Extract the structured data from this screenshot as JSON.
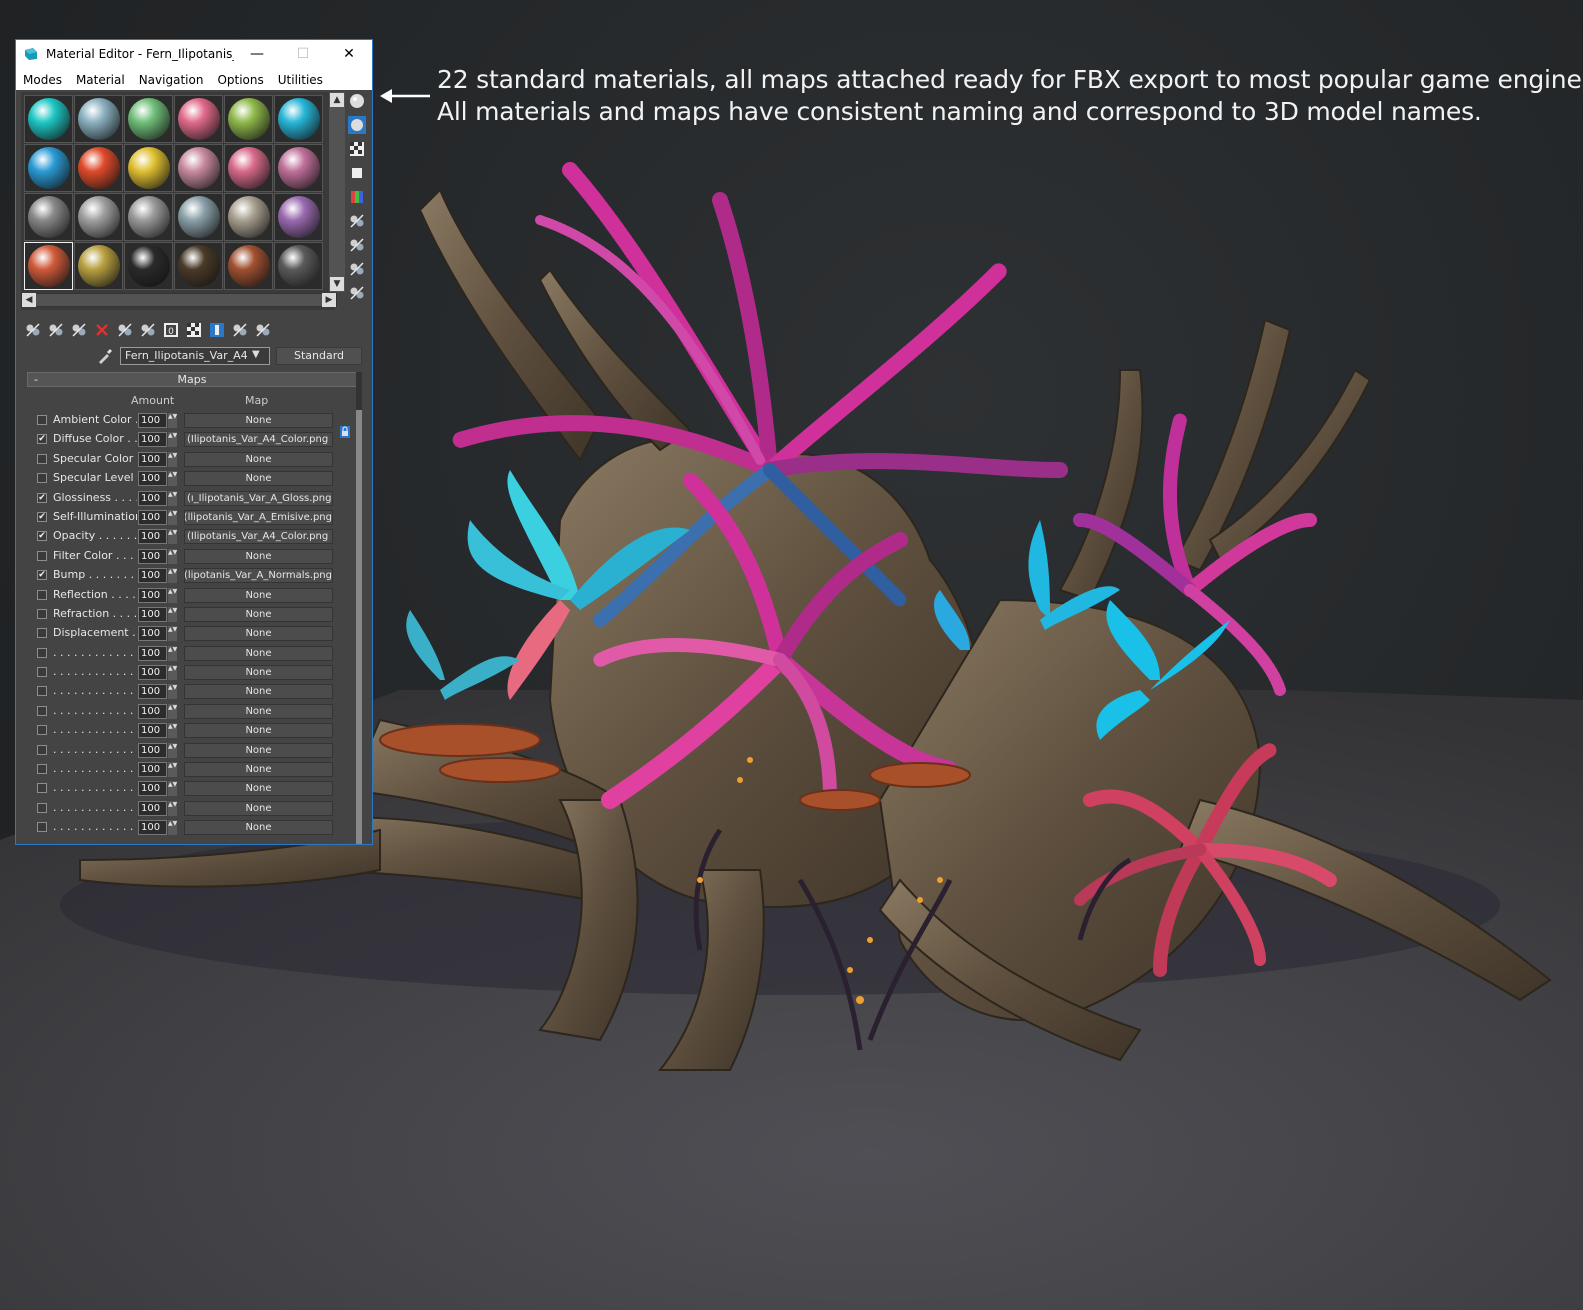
{
  "caption": {
    "line1": "22 standard materials, all maps attached ready for FBX export to most popular game engines.",
    "line2": "All materials and maps have consistent naming and correspond to 3D model names."
  },
  "window": {
    "title": "Material Editor - Fern_Ilipotanis_Va...",
    "app_icon": "3ds-max-icon",
    "minimize": "—",
    "maximize": "☐",
    "close": "✕"
  },
  "menu": [
    "Modes",
    "Material",
    "Navigation",
    "Options",
    "Utilities"
  ],
  "slots": [
    [
      "#1ec8c4",
      "#8ab0c0",
      "#6fbf7a",
      "#e06a8a",
      "#8fb84a",
      "#27b6d8"
    ],
    [
      "#2a9bd6",
      "#e04a2a",
      "#e0c030",
      "#c88aa0",
      "#d86a8a",
      "#c0709a"
    ],
    [
      "#888888",
      "#a0a0a0",
      "#9a9a9a",
      "#8aa0a8",
      "#a8a090",
      "#9a6ab0"
    ],
    [
      "#d05a3a",
      "#b8a040",
      "#2a2a2a",
      "#4a3a28",
      "#a05030",
      "#5a5a5a"
    ]
  ],
  "active_slot": 18,
  "side_tools": [
    "sample-type-icon",
    "backlight-icon",
    "background-icon",
    "sample-uv-tiling-icon",
    "video-color-check-icon",
    "make-preview-icon",
    "options-icon",
    "select-by-material-icon",
    "material-map-navigator-icon"
  ],
  "bottom_tools": [
    "get-material-icon",
    "put-to-scene-icon",
    "assign-to-selection-icon",
    "reset-map-icon",
    "make-unique-icon",
    "put-to-library-icon",
    "material-id-channel-icon",
    "show-shaded-in-viewport-icon",
    "show-end-result-icon",
    "go-to-parent-icon",
    "go-forward-to-sibling-icon"
  ],
  "material_name": "Fern_Ilipotanis_Var_A4",
  "material_type": "Standard",
  "maps_rollout": {
    "title": "Maps",
    "toggle": "-",
    "col_amount": "Amount",
    "col_map": "Map"
  },
  "maps": [
    {
      "label": "Ambient Color . .",
      "checked": false,
      "amount": "100",
      "map": "None",
      "assigned": false
    },
    {
      "label": "Diffuse Color . . .",
      "checked": true,
      "amount": "100",
      "map": "Ilipotanis_Var_A4_Color.png)",
      "assigned": true
    },
    {
      "label": "Specular Color",
      "checked": false,
      "amount": "100",
      "map": "None",
      "assigned": false
    },
    {
      "label": "Specular Level .",
      "checked": false,
      "amount": "100",
      "map": "None",
      "assigned": false
    },
    {
      "label": "Glossiness . . . .",
      "checked": true,
      "amount": "100",
      "map": "ı_Ilipotanis_Var_A_Gloss.png)",
      "assigned": true
    },
    {
      "label": "Self-Illumination .",
      "checked": true,
      "amount": "100",
      "map": "llipotanis_Var_A_Emisive.png)",
      "assigned": true
    },
    {
      "label": "Opacity . . . . . .",
      "checked": true,
      "amount": "100",
      "map": "Ilipotanis_Var_A4_Color.png)",
      "assigned": true
    },
    {
      "label": "Filter Color . . . .",
      "checked": false,
      "amount": "100",
      "map": "None",
      "assigned": false
    },
    {
      "label": "Bump . . . . . . .",
      "checked": true,
      "amount": "100",
      "map": "lipotanis_Var_A_Normals.png)",
      "assigned": true
    },
    {
      "label": "Reflection . . . .",
      "checked": false,
      "amount": "100",
      "map": "None",
      "assigned": false
    },
    {
      "label": "Refraction . . . .",
      "checked": false,
      "amount": "100",
      "map": "None",
      "assigned": false
    },
    {
      "label": "Displacement . .",
      "checked": false,
      "amount": "100",
      "map": "None",
      "assigned": false
    },
    {
      "label": ". . . . . . . . . . . .",
      "checked": false,
      "amount": "100",
      "map": "None",
      "assigned": false
    },
    {
      "label": ". . . . . . . . . . . .",
      "checked": false,
      "amount": "100",
      "map": "None",
      "assigned": false
    },
    {
      "label": ". . . . . . . . . . . .",
      "checked": false,
      "amount": "100",
      "map": "None",
      "assigned": false
    },
    {
      "label": ". . . . . . . . . . . .",
      "checked": false,
      "amount": "100",
      "map": "None",
      "assigned": false
    },
    {
      "label": ". . . . . . . . . . . .",
      "checked": false,
      "amount": "100",
      "map": "None",
      "assigned": false
    },
    {
      "label": ". . . . . . . . . . . .",
      "checked": false,
      "amount": "100",
      "map": "None",
      "assigned": false
    },
    {
      "label": ". . . . . . . . . . . .",
      "checked": false,
      "amount": "100",
      "map": "None",
      "assigned": false
    },
    {
      "label": ". . . . . . . . . . . .",
      "checked": false,
      "amount": "100",
      "map": "None",
      "assigned": false
    },
    {
      "label": ". . . . . . . . . . . .",
      "checked": false,
      "amount": "100",
      "map": "None",
      "assigned": false
    },
    {
      "label": ". . . . . . . . . . . .",
      "checked": false,
      "amount": "100",
      "map": "None",
      "assigned": false
    }
  ],
  "check_mark": "✔",
  "spin_glyph": "▲▼",
  "colors": {
    "accent": "#2a78c8",
    "panel": "#444444",
    "fern_magenta": "#d0309a",
    "fern_cyan": "#19c0e8",
    "coral_red": "#d04060",
    "root_brown": "#6a5a48"
  }
}
